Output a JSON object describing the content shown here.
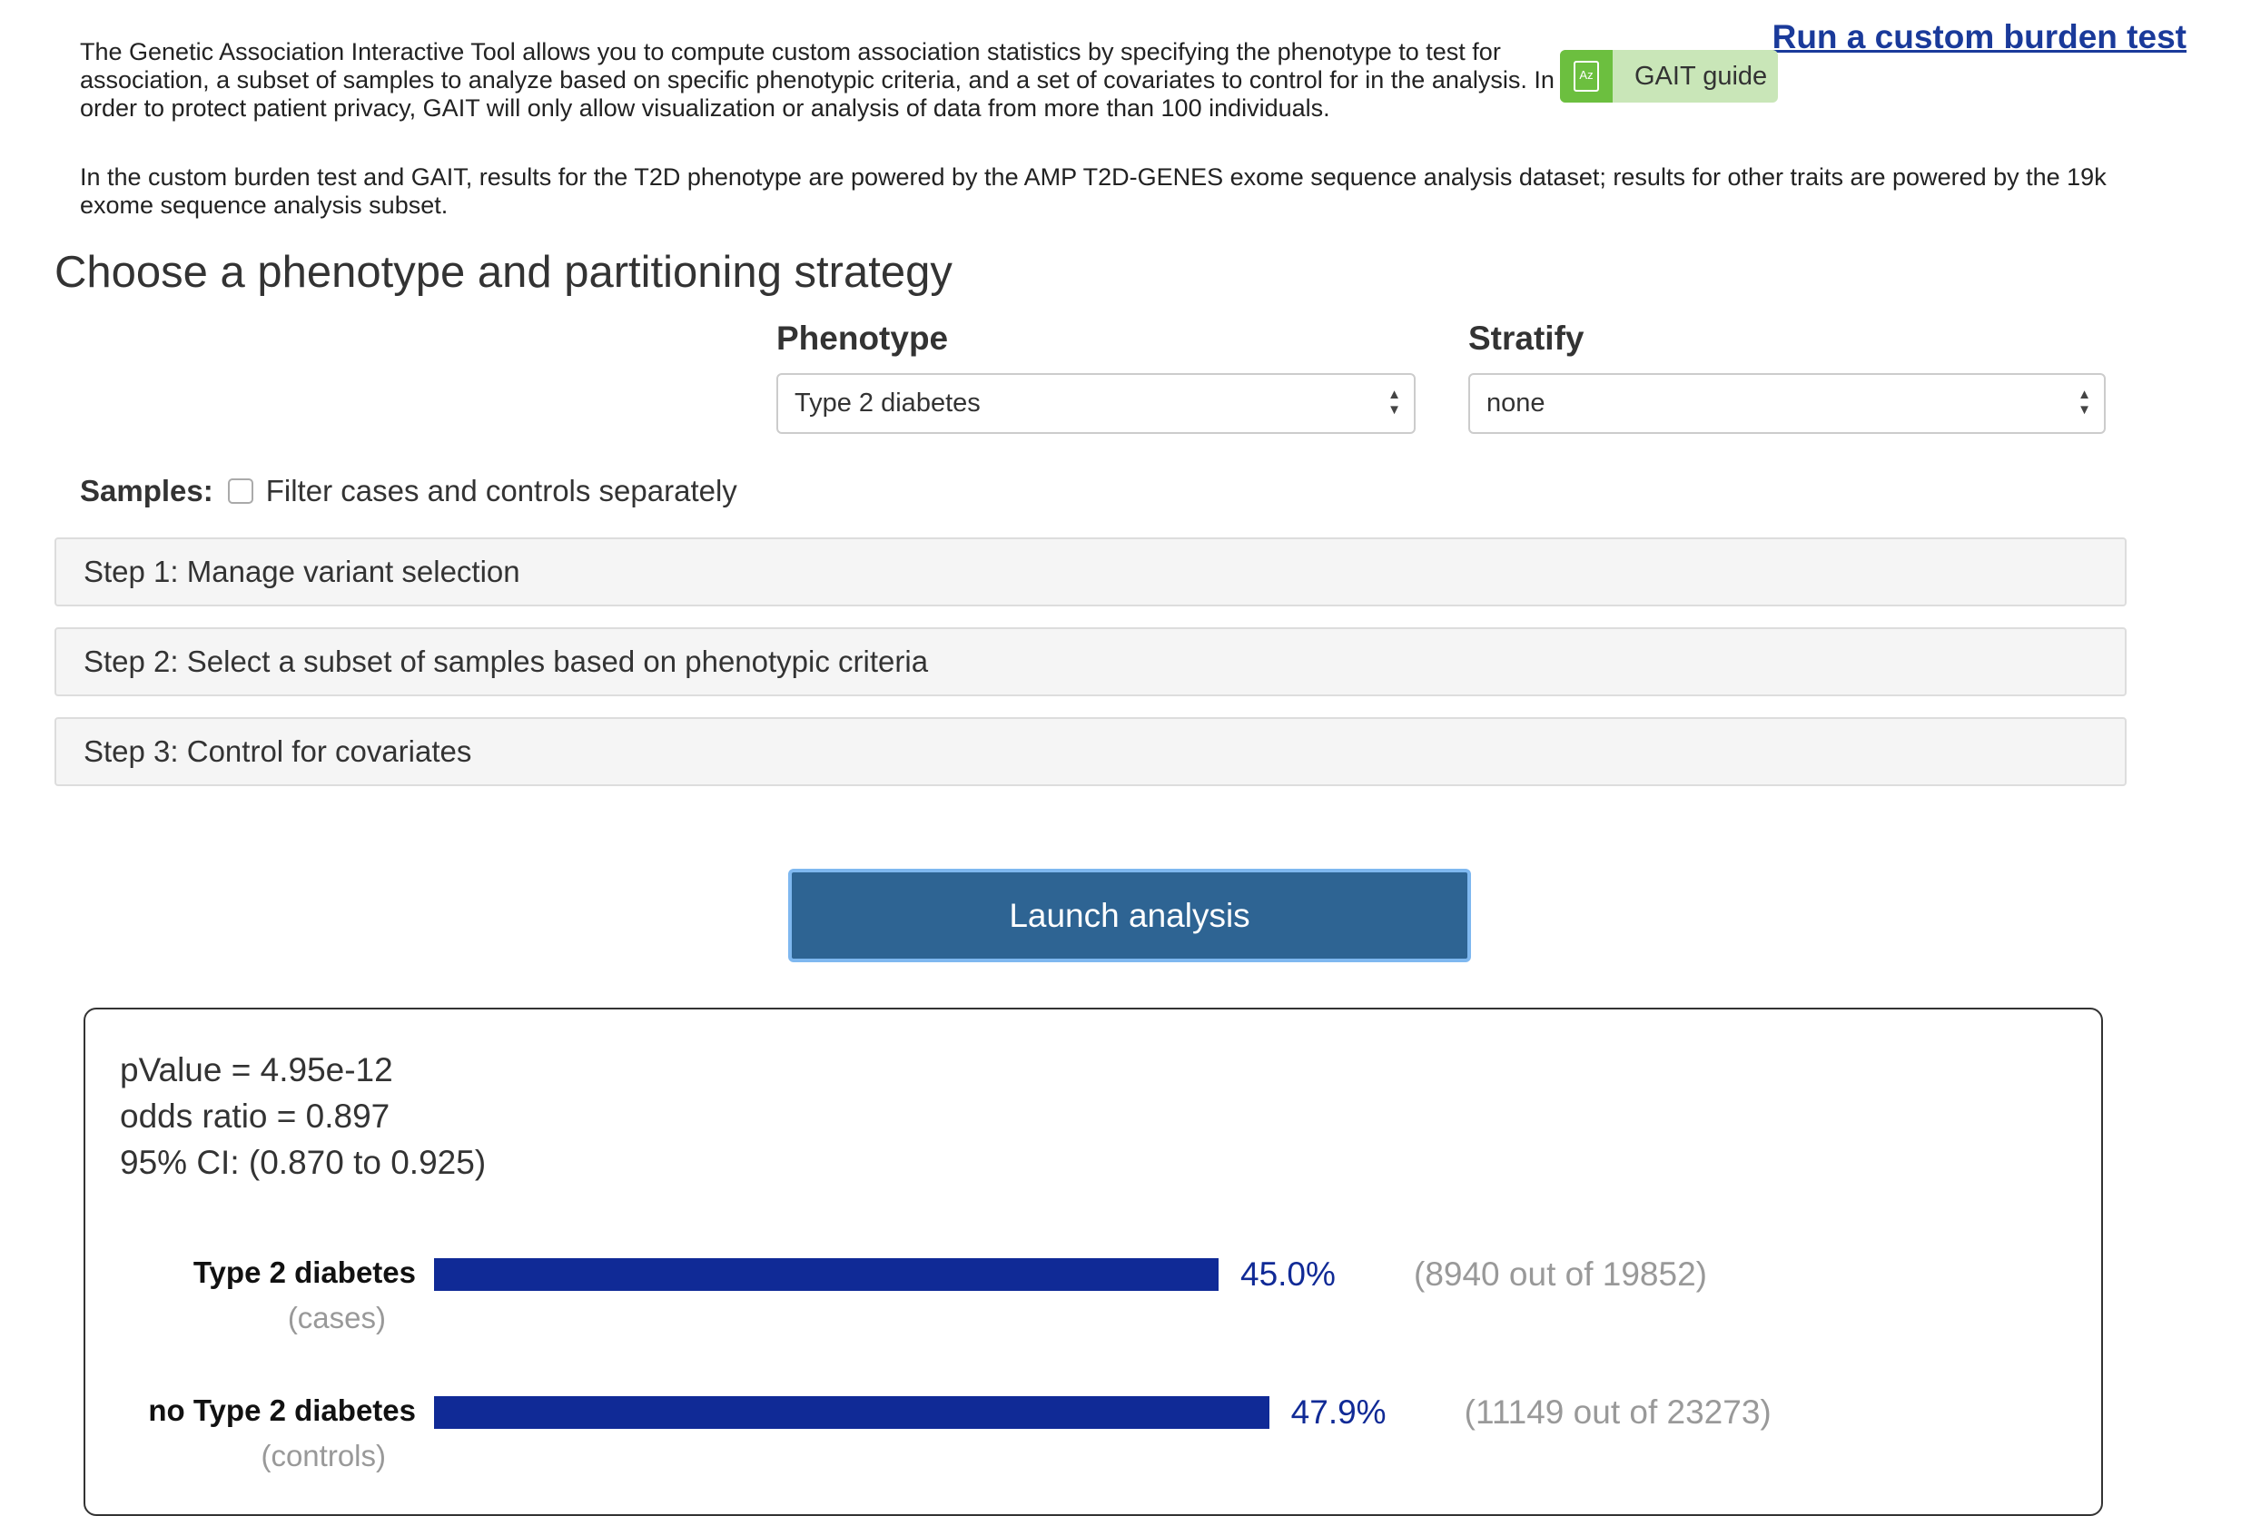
{
  "header": {
    "intro_text": "The Genetic Association Interactive Tool allows you to compute custom association statistics by specifying the phenotype to test for association, a subset of samples to analyze based on specific phenotypic criteria, and a set of covariates to control for in the analysis. In order to protect patient privacy, GAIT will only allow visualization or analysis of data from more than 100 individuals.",
    "dataset_note": "In the custom burden test and GAIT, results for the T2D phenotype are powered by the AMP T2D-GENES exome sequence analysis dataset; results for other traits are powered by the 19k exome sequence analysis subset.",
    "run_link": "Run a custom burden test",
    "guide_button": "GAIT guide",
    "guide_icon_text": "Az",
    "guide_icon_color": "#6cbf3f"
  },
  "section_title": "Choose a phenotype and partitioning strategy",
  "phenotype": {
    "label": "Phenotype",
    "selected": "Type 2 diabetes"
  },
  "stratify": {
    "label": "Stratify",
    "selected": "none"
  },
  "samples": {
    "label": "Samples:",
    "checkbox_label": "Filter cases and controls separately",
    "checked": false
  },
  "steps": [
    {
      "label": "Step 1: Manage variant selection"
    },
    {
      "label": "Step 2: Select a subset of samples based on phenotypic criteria"
    },
    {
      "label": "Step 3: Control for covariates"
    }
  ],
  "launch_button": "Launch analysis",
  "results": {
    "pvalue": "pValue = 4.95e-12",
    "odds_ratio": "odds ratio = 0.897",
    "ci": "95% CI: (0.870 to 0.925)",
    "bar_color": "#102a96",
    "bars": [
      {
        "label": "Type 2 diabetes",
        "sub": "(cases)",
        "percent": 45.0,
        "percent_text": "45.0%",
        "counts": "(8940 out of 19852)"
      },
      {
        "label": "no Type 2 diabetes",
        "sub": "(controls)",
        "percent": 47.9,
        "percent_text": "47.9%",
        "counts": "(11149 out of 23273)"
      }
    ]
  }
}
